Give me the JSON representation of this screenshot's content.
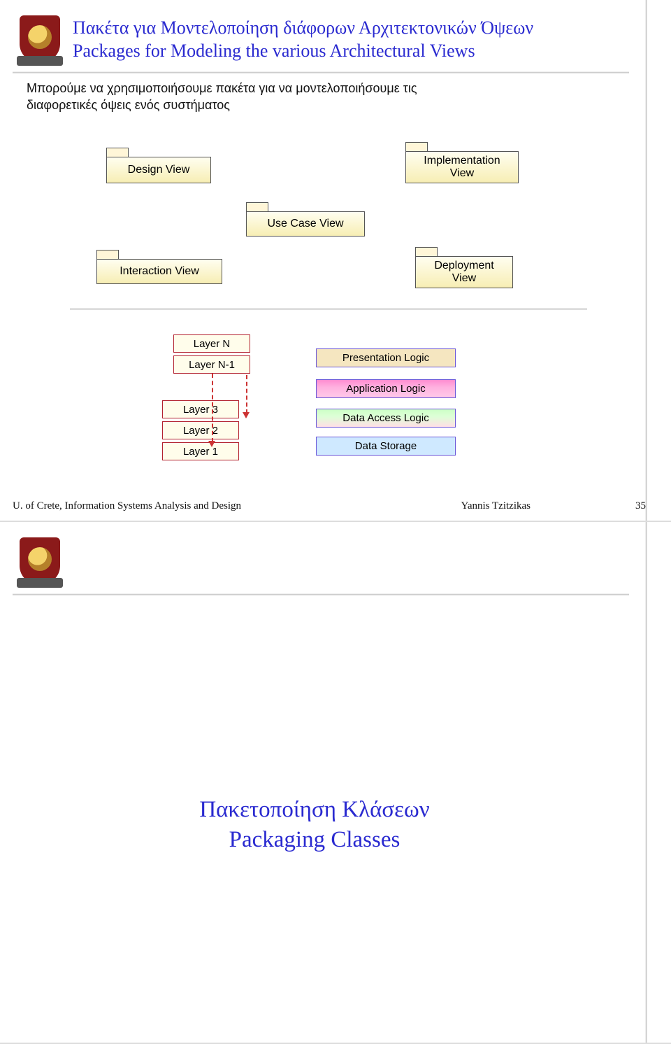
{
  "slide1": {
    "title_gr": "Πακέτα για Μοντελοποίηση διάφορων Αρχιτεκτονικών Όψεων",
    "title_en": "Packages for Modeling the various Architectural Views",
    "body_line1": "Μπορούμε να χρησιμοποιήσουμε πακέτα για να μοντελοποιήσουμε τις",
    "body_line2": "διαφορετικές όψεις ενός συστήματος",
    "packages": {
      "design": "Design View",
      "implementation": "Implementation\nView",
      "usecase": "Use Case View",
      "interaction": "Interaction View",
      "deployment": "Deployment\nView"
    },
    "layers": {
      "n": "Layer N",
      "nm1": "Layer N-1",
      "l3": "Layer 3",
      "l2": "Layer 2",
      "l1": "Layer 1"
    },
    "tiers": {
      "pres": "Presentation Logic",
      "app": "Application Logic",
      "dacc": "Data Access Logic",
      "stor": "Data Storage"
    },
    "footer_left": "U. of Crete, Information Systems Analysis and Design",
    "footer_center": "Yannis Tzitzikas",
    "footer_right": "35"
  },
  "slide2": {
    "title_gr": "Πακετοποίηση Κλάσεων",
    "title_en": "Packaging Classes"
  }
}
